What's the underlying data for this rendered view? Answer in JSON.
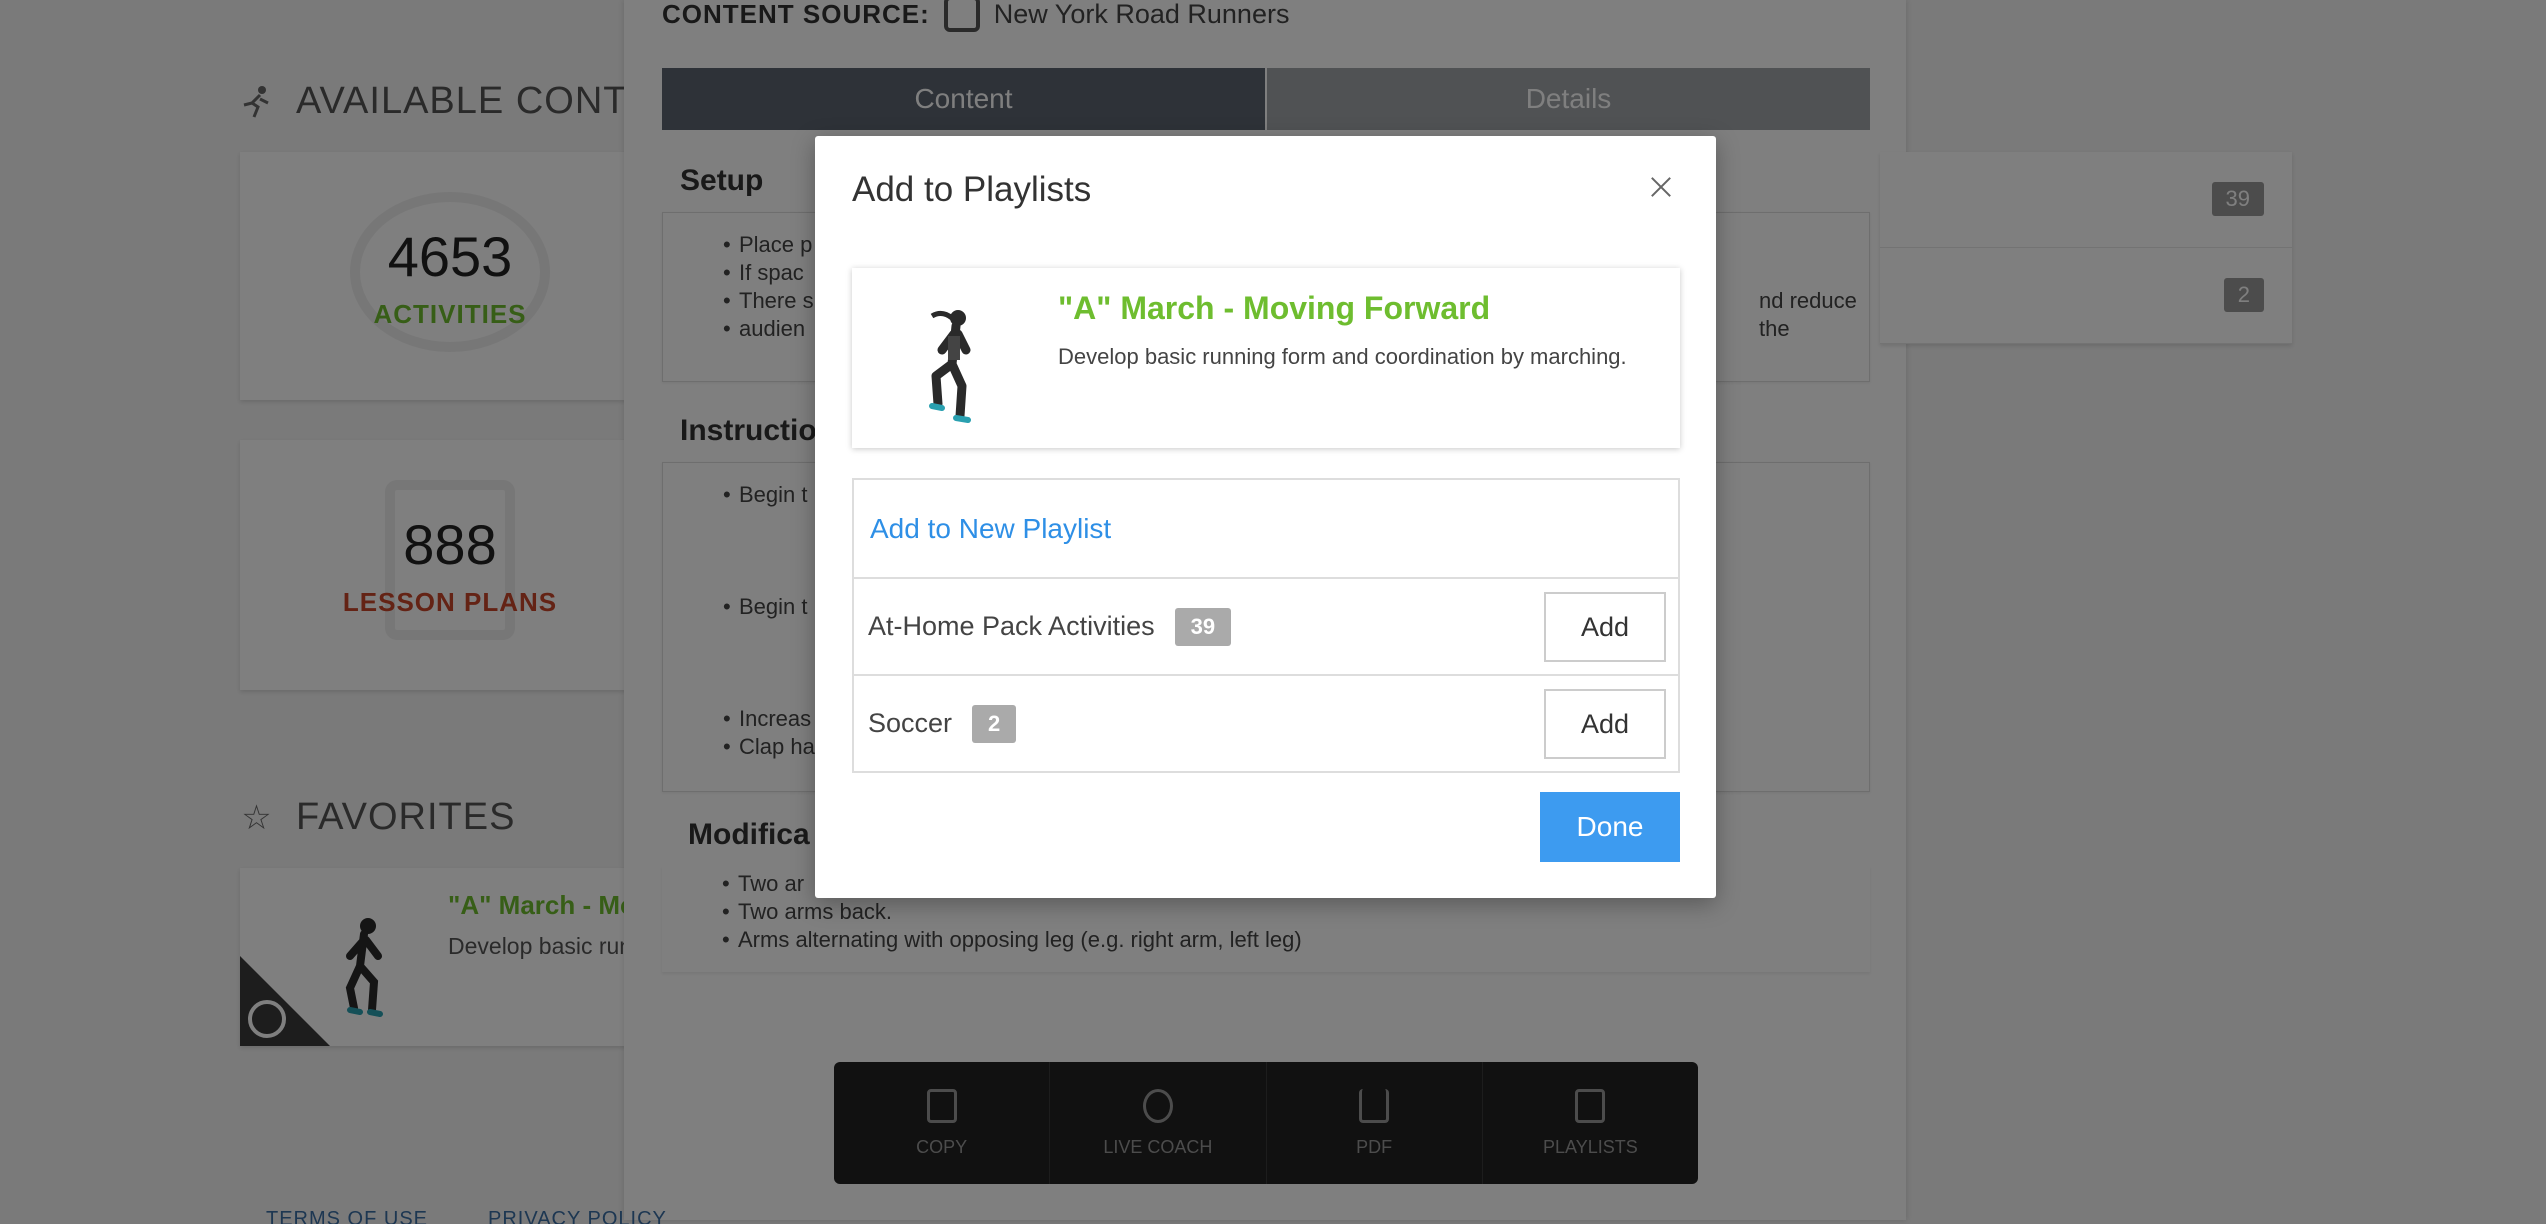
{
  "background": {
    "content_source_label": "CONTENT SOURCE:",
    "content_source_name": "New York Road Runners",
    "available_heading": "AVAILABLE CONTENT",
    "activities": {
      "count": "4653",
      "label": "ACTIVITIES",
      "color": "#6ebd2f"
    },
    "lesson_plans": {
      "count": "888",
      "label": "LESSON PLANS",
      "color": "#c8462b"
    },
    "favorites_heading": "FAVORITES",
    "favorite_item": {
      "title": "\"A\" March - Moving Forward",
      "desc": "Develop basic running form and coordination by marching."
    },
    "tabs": [
      "Content",
      "Details"
    ],
    "setup_title": "Setup",
    "setup_items": [
      "Place p",
      "If spac",
      "There s",
      "audien"
    ],
    "setup_tail": "nd reduce the",
    "instructions_title": "Instruction",
    "instruction_items": [
      "Begin t",
      "Begin t",
      "Increas",
      "Clap ha"
    ],
    "modifications_title": "Modifica",
    "modification_items": [
      "Two ar",
      "Two arms back.",
      "Arms alternating with opposing leg (e.g. right arm, left leg)"
    ],
    "right_badges": [
      "39",
      "2"
    ],
    "toolbar": [
      {
        "label": "COPY",
        "icon": "copy-icon"
      },
      {
        "label": "LIVE COACH",
        "icon": "whistle-icon"
      },
      {
        "label": "PDF",
        "icon": "download-icon"
      },
      {
        "label": "PLAYLISTS",
        "icon": "playlist-icon"
      }
    ],
    "footer": [
      "TERMS OF USE",
      "PRIVACY POLICY"
    ]
  },
  "modal": {
    "title": "Add to Playlists",
    "activity": {
      "title": "\"A\" March - Moving Forward",
      "desc": "Develop basic running form and coordination by marching."
    },
    "new_playlist_label": "Add to New Playlist",
    "playlists": [
      {
        "name": "At-Home Pack Activities",
        "count": "39",
        "action": "Add"
      },
      {
        "name": "Soccer",
        "count": "2",
        "action": "Add"
      }
    ],
    "done_label": "Done",
    "accent_color": "#3d9bf0"
  }
}
